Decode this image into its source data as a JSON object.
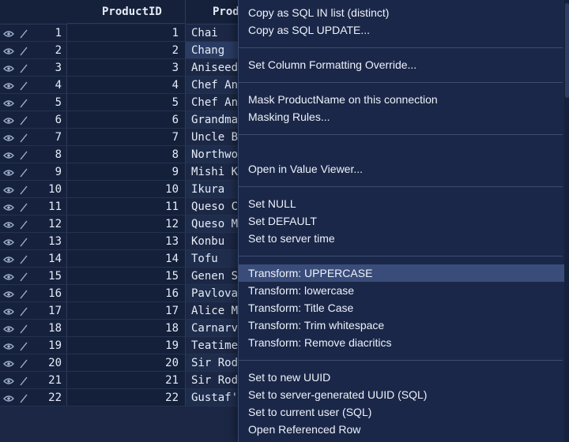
{
  "header": {
    "row_col": "",
    "id_col": "ProductID",
    "name_col": "ProductName"
  },
  "rows": [
    {
      "n": "1",
      "id": "1",
      "name": "Chai"
    },
    {
      "n": "2",
      "id": "2",
      "name": "Chang"
    },
    {
      "n": "3",
      "id": "3",
      "name": "Aniseed"
    },
    {
      "n": "4",
      "id": "4",
      "name": "Chef An"
    },
    {
      "n": "5",
      "id": "5",
      "name": "Chef An"
    },
    {
      "n": "6",
      "id": "6",
      "name": "Grandma"
    },
    {
      "n": "7",
      "id": "7",
      "name": "Uncle B"
    },
    {
      "n": "8",
      "id": "8",
      "name": "Northwo"
    },
    {
      "n": "9",
      "id": "9",
      "name": "Mishi K"
    },
    {
      "n": "10",
      "id": "10",
      "name": "Ikura"
    },
    {
      "n": "11",
      "id": "11",
      "name": "Queso C"
    },
    {
      "n": "12",
      "id": "12",
      "name": "Queso M"
    },
    {
      "n": "13",
      "id": "13",
      "name": "Konbu"
    },
    {
      "n": "14",
      "id": "14",
      "name": "Tofu"
    },
    {
      "n": "15",
      "id": "15",
      "name": "Genen S"
    },
    {
      "n": "16",
      "id": "16",
      "name": "Pavlova"
    },
    {
      "n": "17",
      "id": "17",
      "name": "Alice M"
    },
    {
      "n": "18",
      "id": "18",
      "name": "Carnarv"
    },
    {
      "n": "19",
      "id": "19",
      "name": "Teatime"
    },
    {
      "n": "20",
      "id": "20",
      "name": "Sir Rod"
    },
    {
      "n": "21",
      "id": "21",
      "name": "Sir Rod"
    },
    {
      "n": "22",
      "id": "22",
      "name": "Gustaf'"
    }
  ],
  "selected_row": "2",
  "context_menu": {
    "items": [
      {
        "label": "Copy as SQL IN list (distinct)",
        "name": "menu-copy-sql-in-distinct"
      },
      {
        "label": "Copy as SQL UPDATE...",
        "name": "menu-copy-sql-update"
      },
      {
        "label": "Set Column Formatting Override...",
        "name": "menu-set-column-formatting"
      },
      {
        "label": "Mask ProductName on this connection",
        "name": "menu-mask-productname"
      },
      {
        "label": "Masking Rules...",
        "name": "menu-masking-rules"
      },
      {
        "label": "Open in Value Viewer...",
        "name": "menu-open-value-viewer"
      },
      {
        "label": "Set NULL",
        "name": "menu-set-null"
      },
      {
        "label": "Set DEFAULT",
        "name": "menu-set-default"
      },
      {
        "label": "Set to server time",
        "name": "menu-set-server-time"
      },
      {
        "label": "Transform: UPPERCASE",
        "name": "menu-transform-uppercase"
      },
      {
        "label": "Transform: lowercase",
        "name": "menu-transform-lowercase"
      },
      {
        "label": "Transform: Title Case",
        "name": "menu-transform-title-case"
      },
      {
        "label": "Transform: Trim whitespace",
        "name": "menu-transform-trim"
      },
      {
        "label": "Transform: Remove diacritics",
        "name": "menu-transform-remove-diacritics"
      },
      {
        "label": "Set to new UUID",
        "name": "menu-set-new-uuid"
      },
      {
        "label": "Set to server-generated UUID (SQL)",
        "name": "menu-set-server-uuid"
      },
      {
        "label": "Set to current user (SQL)",
        "name": "menu-set-current-user"
      },
      {
        "label": "Open Referenced Row",
        "name": "menu-open-referenced-row"
      }
    ],
    "highlighted": "Transform: UPPERCASE"
  },
  "colors": {
    "background": "#1b2744",
    "menu": "#1a2748",
    "highlight": "#3a4d7a",
    "text": "#e6ecf7"
  }
}
